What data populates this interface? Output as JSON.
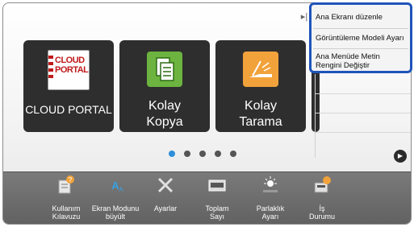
{
  "tiles": [
    {
      "label_line1": "CLOUD PORTAL",
      "label_line2": "",
      "icon": "cloud-portal-icon",
      "icon_text_1": "CLOUD",
      "icon_text_2": "PORTAL"
    },
    {
      "label_line1": "Kolay",
      "label_line2": "Kopya",
      "icon": "copy-icon"
    },
    {
      "label_line1": "Kolay",
      "label_line2": "Tarama",
      "icon": "scan-icon"
    }
  ],
  "pagination": {
    "pages": 5,
    "active": 1
  },
  "side_menu": {
    "items": [
      {
        "label": "Ana Ekranı düzenle"
      },
      {
        "label": "Görüntüleme Modeli Ayarı"
      },
      {
        "label_line1": "Ana Menüde Metin",
        "label_line2": "Rengini Değiştir"
      }
    ]
  },
  "bottom_bar": {
    "items": [
      {
        "label_line1": "Kullanım",
        "label_line2": "Kılavuzu",
        "icon": "manual-icon"
      },
      {
        "label_line1": "Ekran Modunu",
        "label_line2": "büyült",
        "icon": "screen-mode-icon"
      },
      {
        "label_line1": "Ayarlar",
        "label_line2": "",
        "icon": "settings-icon"
      },
      {
        "label_line1": "Toplam",
        "label_line2": "Sayı",
        "icon": "total-count-icon"
      },
      {
        "label_line1": "Parlaklık",
        "label_line2": "Ayarı",
        "icon": "brightness-icon"
      },
      {
        "label_line1": "İş",
        "label_line2": "Durumu",
        "icon": "job-status-icon"
      }
    ]
  },
  "colors": {
    "accent": "#1f54b9",
    "active_dot": "#2f8fd8",
    "copy_tile": "#6cb43f",
    "scan_tile": "#f2a23a",
    "cloud_red": "#c01a1a"
  }
}
